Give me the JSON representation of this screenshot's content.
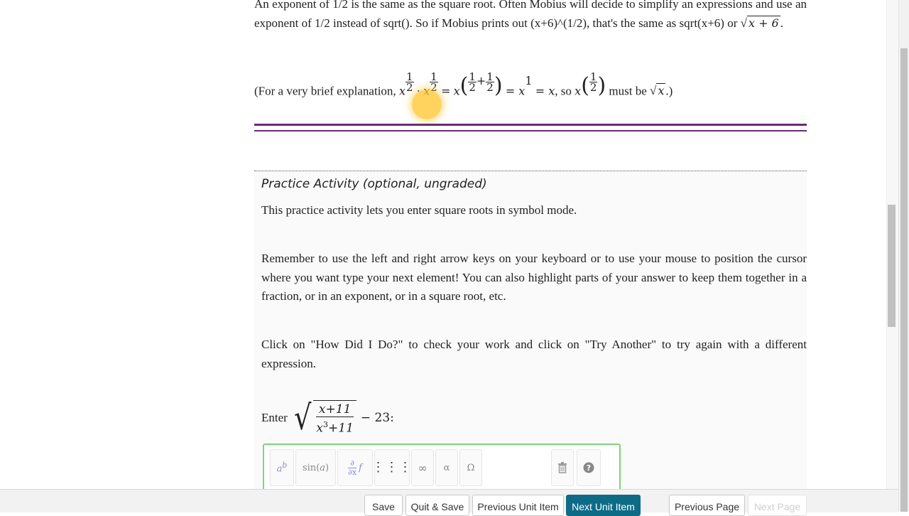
{
  "intro": {
    "text": "An exponent of 1/2 is the same as the square root. Often Mobius will decide to simplify an expressions and use an exponent of 1/2 instead of sqrt(). So if Mobius prints out (x+6)^(1/2), that's the same as sqrt(x+6) or",
    "math": "x + 6"
  },
  "explanation": {
    "prefix": "(For a very brief explanation,",
    "so": ", so",
    "must_be": "must be",
    "suffix": ".)"
  },
  "practice": {
    "title": "Practice Activity (optional, ungraded)",
    "p1": "This practice activity lets you enter square roots in symbol mode.",
    "p2": "Remember to use the left and right arrow keys on your keyboard or to use your mouse to position the cursor where you want type your next element! You can also highlight parts of your answer to keep them together in a fraction, or in an exponent, or in a square root, etc.",
    "p3": "Click on \"How Did I Do?\" to check your work and click on \"Try Another\" to try again with a different expression.",
    "enter_label": "Enter",
    "expr_num": "x+11",
    "expr_den": "x3+11",
    "expr_tail": "− 23:",
    "colon": ":"
  },
  "toolbar": {
    "power": "a^b",
    "sin": "sin(a)",
    "partial": "∂/∂x f",
    "matrix": "matrix",
    "infinity": "∞",
    "alpha": "α",
    "omega": "Ω"
  },
  "footer": {
    "save": "Save",
    "quit_save": "Quit & Save",
    "prev_unit": "Previous Unit Item",
    "next_unit": "Next Unit Item",
    "prev_page": "Previous Page",
    "next_page": "Next Page"
  },
  "colors": {
    "accent": "#0e6b86",
    "rule": "#6b2a7a",
    "editor_border": "#7bd67b",
    "highlight": "#ffc428"
  }
}
